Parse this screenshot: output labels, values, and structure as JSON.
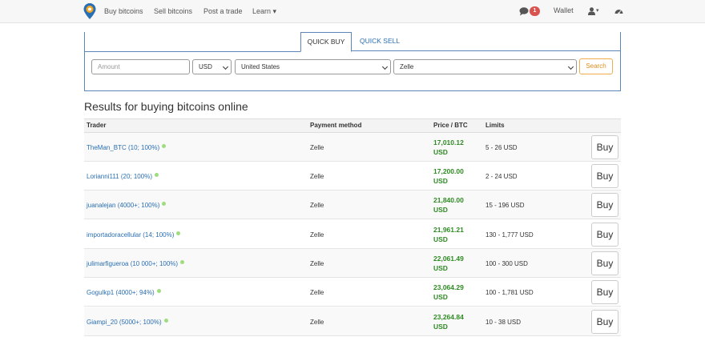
{
  "nav": {
    "links": [
      "Buy bitcoins",
      "Sell bitcoins",
      "Post a trade",
      "Learn ▾"
    ],
    "notifications": "1",
    "wallet": "Wallet",
    "user": "▾",
    "accent": "#2a6fb3"
  },
  "tabs": {
    "quick_buy": "QUICK BUY",
    "quick_sell": "QUICK SELL"
  },
  "form": {
    "amount_placeholder": "Amount",
    "currency": "USD",
    "country": "United States",
    "payment": "Zelle",
    "search": "Search"
  },
  "results_title": "Results for buying bitcoins online",
  "table": {
    "headers": [
      "Trader",
      "Payment method",
      "Price / BTC",
      "Limits"
    ],
    "rows": [
      {
        "trader": "TheMan_BTC (10; 100%)",
        "payment": "Zelle",
        "price": "17,010.12",
        "currency": "USD",
        "limits": "5 - 26 USD",
        "action": "Buy"
      },
      {
        "trader": "Lorianni111 (20; 100%)",
        "payment": "Zelle",
        "price": "17,200.00",
        "currency": "USD",
        "limits": "2 - 24 USD",
        "action": "Buy"
      },
      {
        "trader": "juanalejan (4000+; 100%)",
        "payment": "Zelle",
        "price": "21,840.00",
        "currency": "USD",
        "limits": "15 - 196 USD",
        "action": "Buy"
      },
      {
        "trader": "importadoracellular (14; 100%)",
        "payment": "Zelle",
        "price": "21,961.21",
        "currency": "USD",
        "limits": "130 - 1,777 USD",
        "action": "Buy"
      },
      {
        "trader": "julimarfigueroa (10 000+; 100%)",
        "payment": "Zelle",
        "price": "22,061.49",
        "currency": "USD",
        "limits": "100 - 300 USD",
        "action": "Buy"
      },
      {
        "trader": "Gogulkp1 (4000+; 94%)",
        "payment": "Zelle",
        "price": "23,064.29",
        "currency": "USD",
        "limits": "100 - 1,781 USD",
        "action": "Buy"
      },
      {
        "trader": "Giampi_20 (5000+; 100%)",
        "payment": "Zelle",
        "price": "23,264.84",
        "currency": "USD",
        "limits": "10 - 38 USD",
        "action": "Buy"
      }
    ]
  }
}
